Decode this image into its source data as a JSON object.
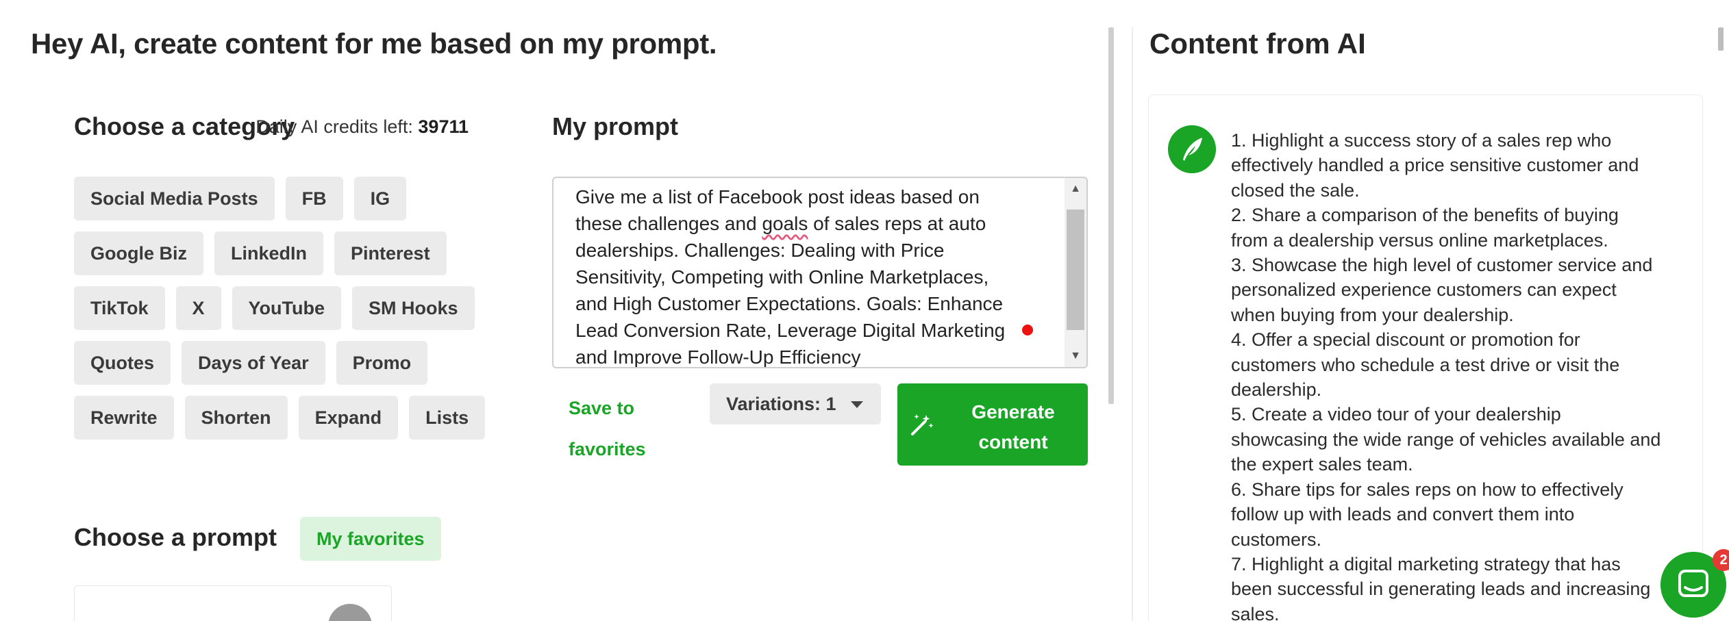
{
  "header": {
    "title": "Hey AI, create content for me based on my prompt."
  },
  "category": {
    "title": "Choose a category",
    "rows": [
      [
        "Social Media Posts",
        "FB",
        "IG"
      ],
      [
        "Google Biz",
        "LinkedIn",
        "Pinterest"
      ],
      [
        "TikTok",
        "X",
        "YouTube",
        "SM Hooks"
      ],
      [
        "Quotes",
        "Days of Year",
        "Promo"
      ],
      [
        "Rewrite",
        "Shorten",
        "Expand",
        "Lists"
      ]
    ]
  },
  "prompt": {
    "title": "My prompt",
    "credits_label": "Daily AI credits left:",
    "credits_value": "39711",
    "lines": [
      {
        "pre": "Give me a list of Facebook post ideas based on",
        "spell": "",
        "post": ""
      },
      {
        "pre": "these challenges and ",
        "spell": "goals",
        "post": " of sales reps at auto"
      },
      {
        "pre": "dealerships. Challenges: Dealing with Price",
        "spell": "",
        "post": ""
      },
      {
        "pre": "Sensitivity, Competing with Online Marketplaces,",
        "spell": "",
        "post": ""
      },
      {
        "pre": "and High Customer Expectations. Goals: Enhance",
        "spell": "",
        "post": ""
      },
      {
        "pre": "Lead Conversion Rate, Leverage Digital Marketing",
        "spell": "",
        "post": ""
      },
      {
        "pre": "and Improve Follow-Up Efficiency",
        "spell": "",
        "post": ""
      }
    ],
    "save_favorites": "Save to favorites",
    "variations": "Variations: 1",
    "generate": "Generate content"
  },
  "choose_prompt": {
    "title": "Choose a prompt",
    "favorites": "My favorites"
  },
  "ai": {
    "title": "Content from AI",
    "lines": [
      "1. Highlight a success story of a sales rep who",
      "effectively handled a price sensitive customer and",
      "closed the sale.",
      "2. Share a comparison of the benefits of buying",
      "from a dealership versus online marketplaces.",
      "3. Showcase the high level of customer service and",
      "personalized experience customers can expect",
      "when buying from your dealership.",
      "4. Offer a special discount or promotion for",
      "customers who schedule a test drive or visit the",
      "dealership.",
      "5. Create a video tour of your dealership",
      "showcasing the wide range of vehicles available and",
      "the expert sales team.",
      "6. Share tips for sales reps on how to effectively",
      "follow up with leads and convert them into",
      "customers.",
      "7. Highlight a digital marketing strategy that has",
      "been successful in generating leads and increasing",
      "sales."
    ]
  },
  "chat": {
    "badge": "2"
  },
  "colors": {
    "brand_green": "#1aa527",
    "chip_bg": "#ebebeb",
    "fav_bg": "#dcf3dd"
  },
  "icons": {
    "generate": "magic-wand-icon",
    "ai_avatar": "feather-icon",
    "chat": "chat-bubble-icon",
    "dropdown": "caret-down-icon"
  }
}
